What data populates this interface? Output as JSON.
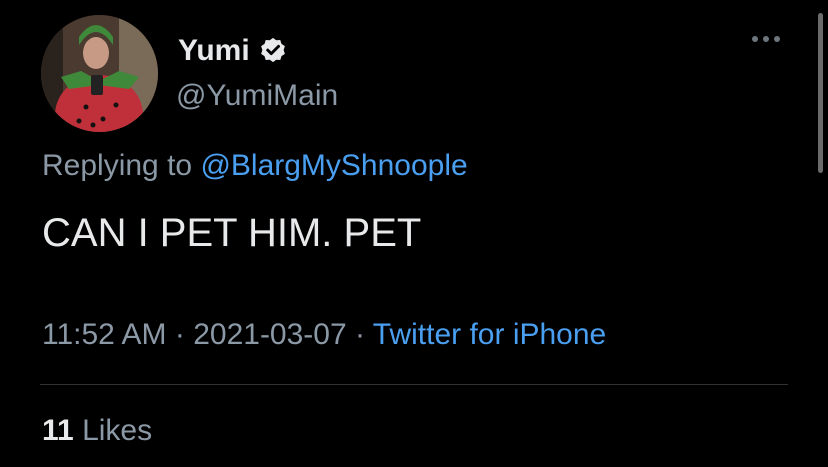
{
  "author": {
    "display_name": "Yumi",
    "handle": "@YumiMain",
    "verified": true
  },
  "reply": {
    "prefix": "Replying to",
    "mention": "@BlargMyShnoople"
  },
  "tweet": {
    "text": "CAN I PET HIM. PET"
  },
  "meta": {
    "time": "11:52 AM",
    "separator": " · ",
    "date": "2021-03-07",
    "source": "Twitter for iPhone"
  },
  "stats": {
    "likes_count": "11",
    "likes_label": "Likes"
  },
  "icons": {
    "verified": "verified-badge-icon",
    "more": "more-options-icon"
  },
  "colors": {
    "background": "#000000",
    "primary_text": "#e7e9ea",
    "secondary_text": "#8b98a5",
    "link": "#4a9ff0"
  }
}
